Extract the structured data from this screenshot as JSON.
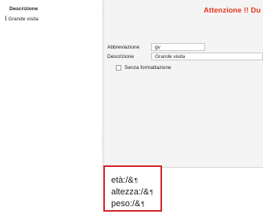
{
  "list": {
    "column_header": "Descrizione",
    "items": [
      {
        "label": "Grande visita"
      }
    ]
  },
  "detail": {
    "warning": "Attenzione !! Du",
    "fields": {
      "abbreviazione": {
        "label": "Abbreviazione",
        "value": "gv"
      },
      "descrizione": {
        "label": "Descrizione",
        "value": "Grande visita"
      }
    },
    "checkbox": {
      "label": "Senza formattazione",
      "checked": false
    }
  },
  "editor": {
    "lines": [
      {
        "text": "età:/&",
        "mark": "¶"
      },
      {
        "text": "altezza:/&",
        "mark": "¶"
      },
      {
        "text": "peso:/&",
        "mark": "¶"
      }
    ]
  },
  "colors": {
    "warning": "#e53a1c",
    "highlight_border": "#d0232a",
    "panel_bg": "#f4f4f4"
  },
  "icons": {
    "text_cursor": "I-beam-icon"
  }
}
